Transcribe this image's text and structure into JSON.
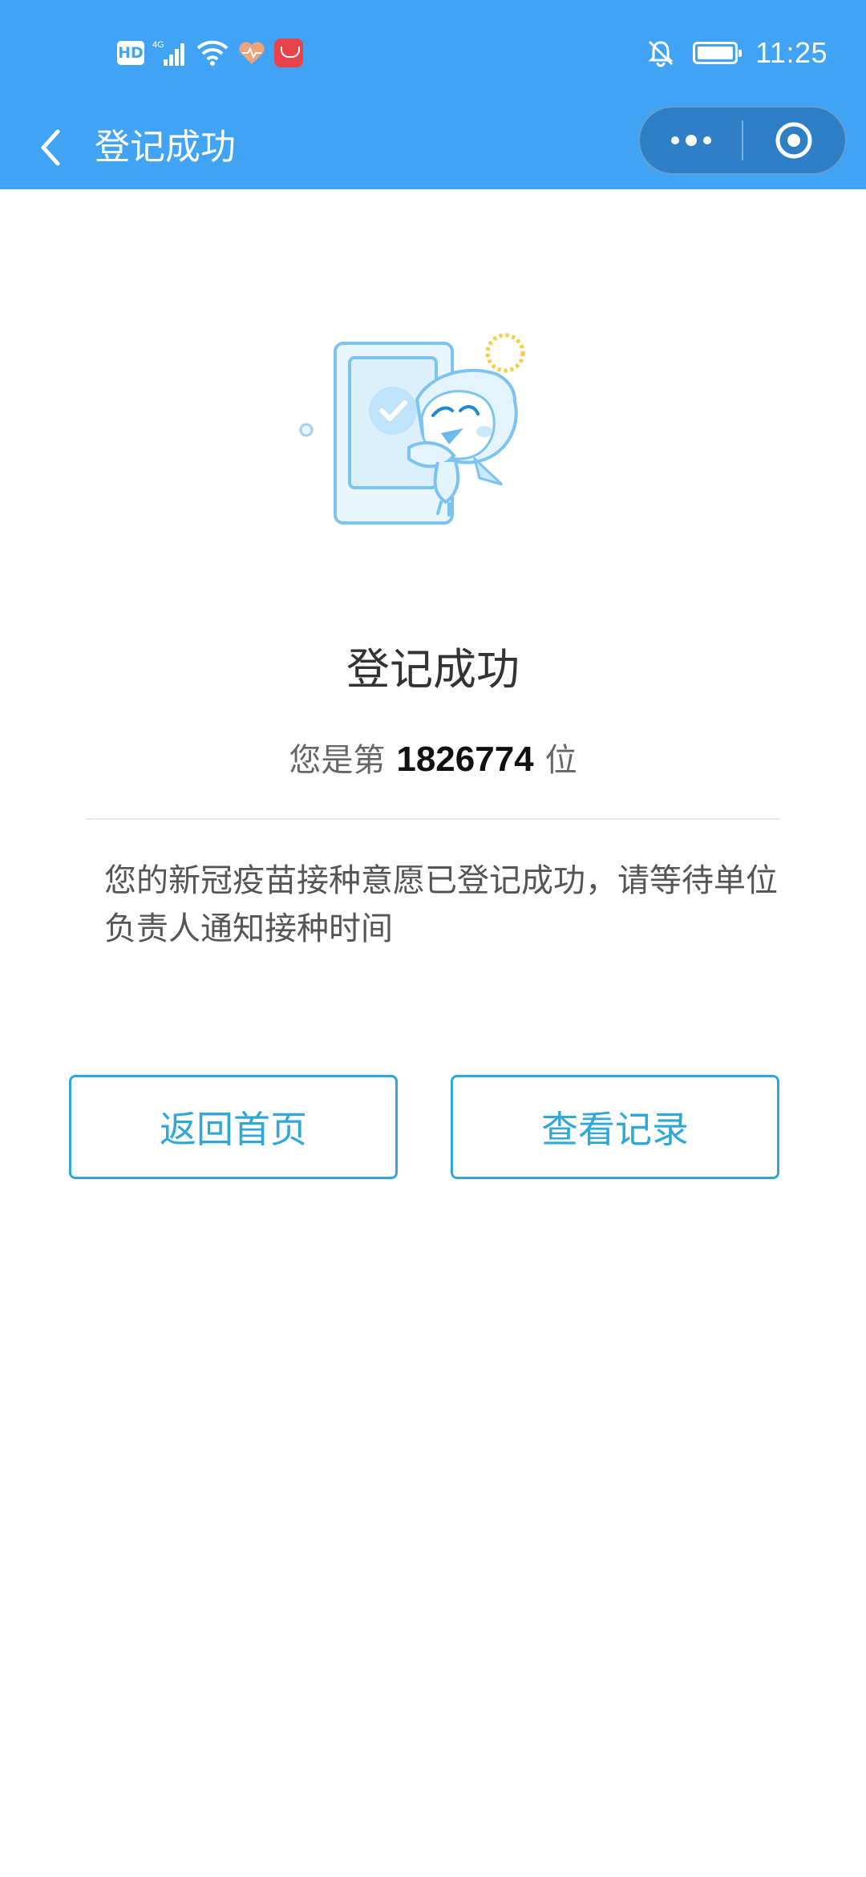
{
  "status_bar": {
    "hd_label": "HD",
    "network_label": "4G",
    "time": "11:25",
    "icons": [
      "hd-icon",
      "signal-icon",
      "wifi-icon",
      "health-app-icon",
      "app-store-icon",
      "mute-bell-icon",
      "battery-icon"
    ]
  },
  "nav": {
    "title": "登记成功",
    "back_icon": "chevron-left-icon",
    "more_icon": "more-dots-icon",
    "close_icon": "target-circle-icon"
  },
  "result": {
    "title": "登记成功",
    "rank_prefix": "您是第",
    "rank_number": "1826774",
    "rank_suffix": "位",
    "description": "您的新冠疫苗接种意愿已登记成功，请等待单位负责人通知接种时间"
  },
  "buttons": {
    "home": "返回首页",
    "records": "查看记录"
  },
  "colors": {
    "header_bg": "#41a3f4",
    "capsule_bg": "#2f7fc6",
    "button_accent": "#30a7d9",
    "title_text": "#333333"
  }
}
